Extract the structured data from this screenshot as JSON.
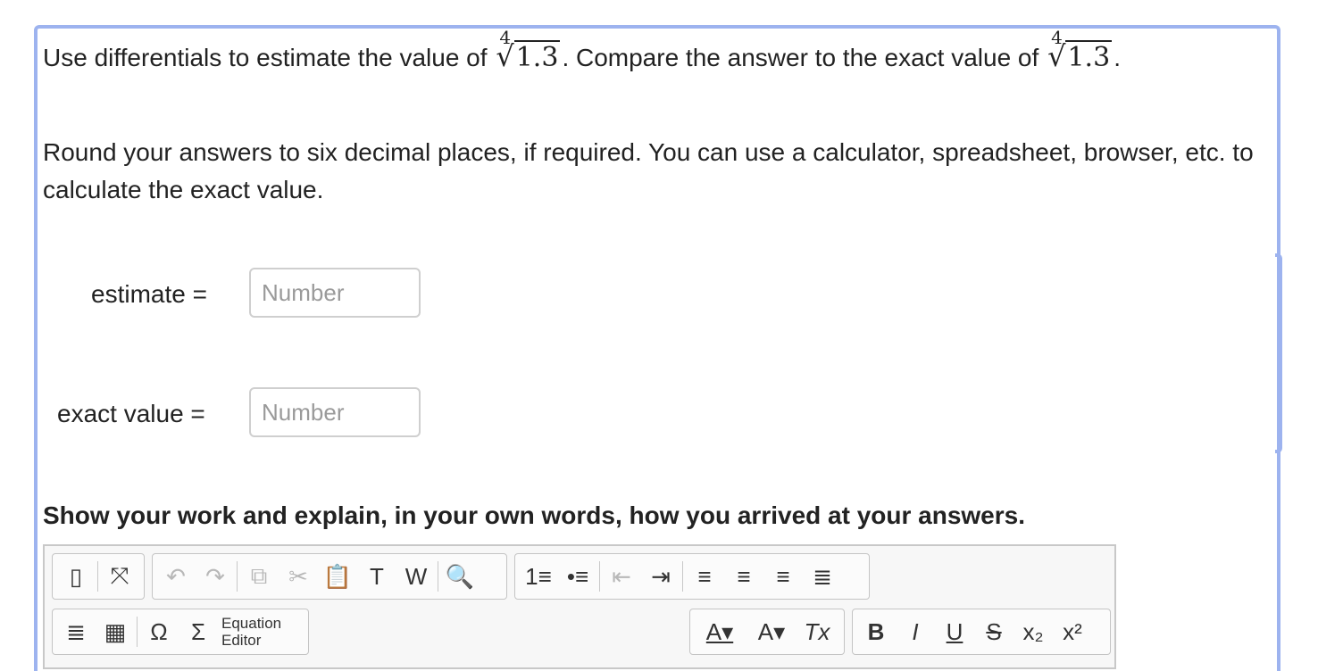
{
  "question": {
    "intro": "Use differentials to estimate the value of",
    "middle": ". Compare the answer to the exact value of",
    "end": ".",
    "root_index": "4",
    "radicand": "1.3",
    "instructions": "Round your answers to six decimal places, if required. You can use a calculator, spreadsheet, browser, etc. to calculate the exact value."
  },
  "fields": {
    "estimate_label": "estimate =",
    "exact_label": "exact value =",
    "placeholder": "Number"
  },
  "work": {
    "heading": "Show your work and explain, in your own words, how you arrived at your answers."
  },
  "toolbar": {
    "equation_line1": "Equation",
    "equation_line2": "Editor",
    "glyphs": {
      "source": "▯",
      "maximize": "⤧",
      "undo": "↶",
      "redo": "↷",
      "copy": "⧉",
      "cut": "✂",
      "paste": "📋",
      "paste_text": "T",
      "paste_word": "W",
      "find": "🔍",
      "numbered_list": "1≡",
      "bulleted_list": "•≡",
      "outdent": "⇤",
      "indent": "⇥",
      "align_left": "≡",
      "align_center": "≡",
      "align_right": "≡",
      "justify": "≣",
      "blocks": "≣",
      "table": "▦",
      "special_char": "Ω",
      "sigma": "Σ",
      "text_color": "A▾",
      "bg_color": "A▾",
      "remove_format": "Tx",
      "bold": "B",
      "italic": "I",
      "underline": "U",
      "strike": "S",
      "subscript": "x₂",
      "superscript": "x²"
    }
  },
  "colors": {
    "accent_border": "#9db3ef"
  }
}
